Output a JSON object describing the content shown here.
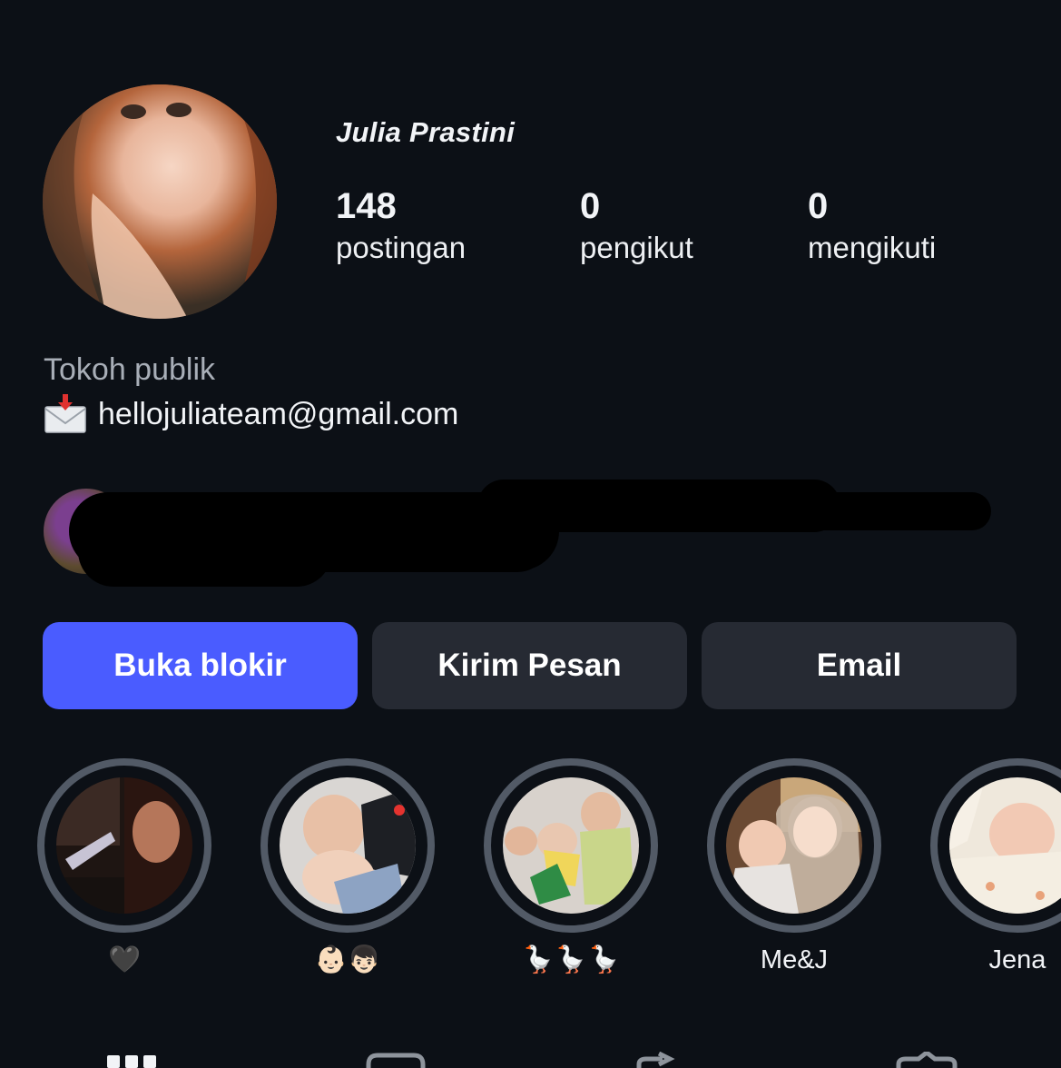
{
  "profile": {
    "display_name": "Julia Prastini",
    "stats": [
      {
        "value": "148",
        "label": "postingan"
      },
      {
        "value": "0",
        "label": "pengikut"
      },
      {
        "value": "0",
        "label": "mengikuti"
      }
    ],
    "category": "Tokoh publik",
    "email": "hellojuliateam@gmail.com"
  },
  "actions": {
    "unblock_label": "Buka blokir",
    "message_label": "Kirim Pesan",
    "email_label": "Email"
  },
  "highlights": [
    {
      "label": "🖤"
    },
    {
      "label": "👶🏻👦🏻"
    },
    {
      "label": "🪿🪿🪿"
    },
    {
      "label": "Me&J"
    },
    {
      "label": "Jena"
    }
  ],
  "colors": {
    "background": "#0c1016",
    "primary_button": "#4a5cff",
    "secondary_button": "#262a33",
    "highlight_ring": "#525a66",
    "muted_text": "#a8aeb7"
  },
  "icons": {
    "email_prefix": "envelope-with-arrow-icon",
    "tabbar": [
      "grid-icon",
      "reels-icon",
      "share-icon",
      "tagged-icon"
    ]
  }
}
